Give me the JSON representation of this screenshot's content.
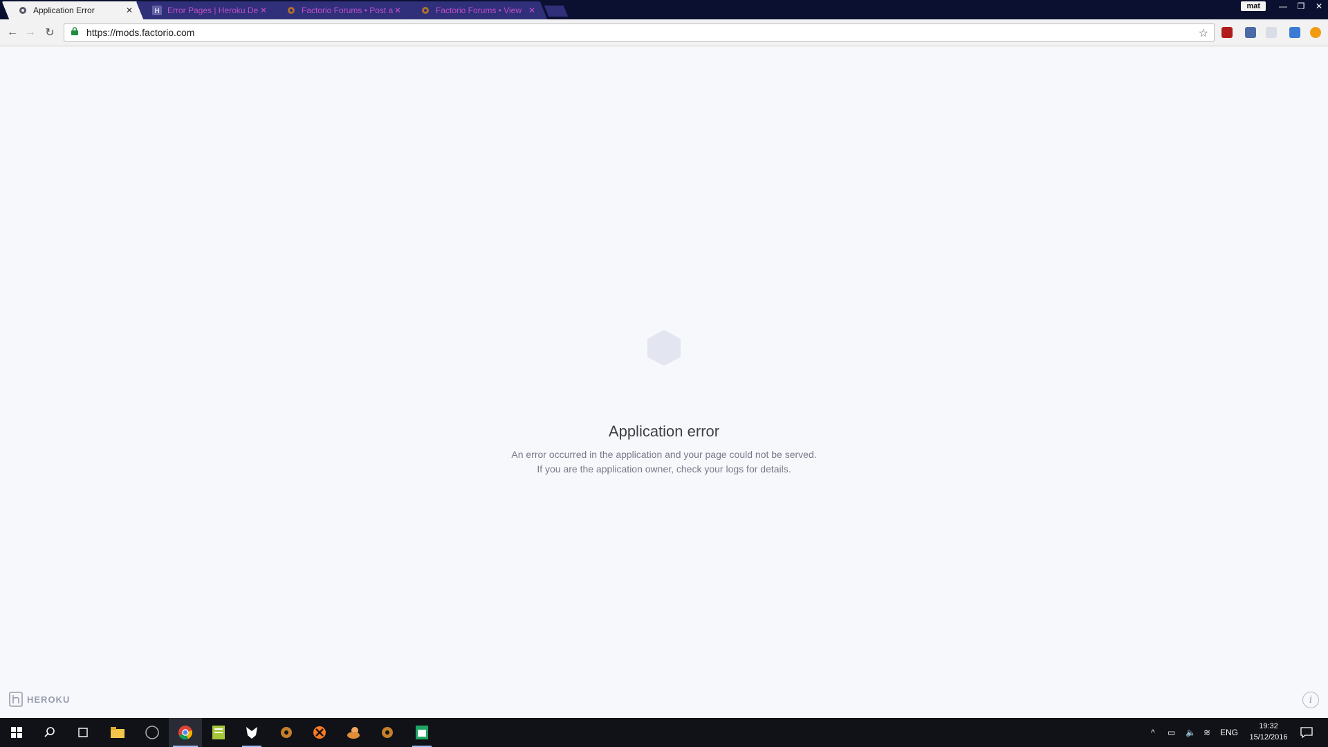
{
  "browser": {
    "tabs": [
      {
        "title": "Application Error",
        "favicon": "gear-icon",
        "active": true
      },
      {
        "title": "Error Pages | Heroku De",
        "favicon": "heroku-icon",
        "active": false
      },
      {
        "title": "Factorio Forums • Post a",
        "favicon": "gear-icon",
        "active": false
      },
      {
        "title": "Factorio Forums • View",
        "favicon": "gear-icon",
        "active": false
      }
    ],
    "profile_name": "mat",
    "url": "https://mods.factorio.com"
  },
  "page": {
    "error_title": "Application error",
    "error_message": "An error occurred in the application and your page could not be served. If you are the application owner, check your logs for details.",
    "brand": "HEROKU",
    "info_glyph": "i"
  },
  "taskbar": {
    "time": "19:32",
    "date": "15/12/2016",
    "language": "ENG"
  }
}
